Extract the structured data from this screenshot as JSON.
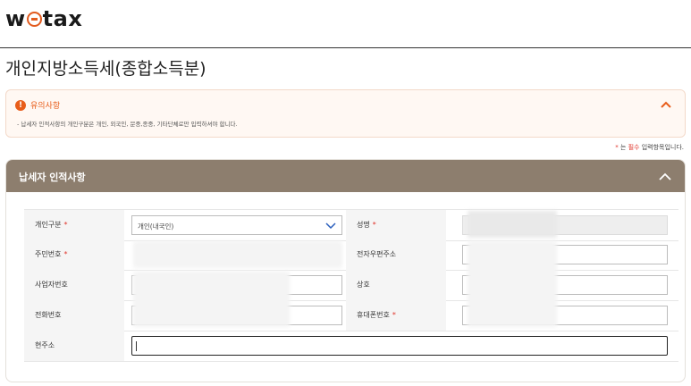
{
  "header": {
    "logo_w": "w",
    "logo_tax": "tax"
  },
  "page": {
    "title": "개인지방소득세(종합소득분)"
  },
  "notice": {
    "icon": "!",
    "title": "유의사항",
    "body": "- 납세자 인적사항의 개인구분은 개인, 외국인, 문중,종중, 기타단체로만 입력하셔야 합니다."
  },
  "required_note": {
    "star": "*",
    "text_a": " 는 ",
    "emphasis": "필수",
    "text_b": " 입력항목입니다."
  },
  "panel": {
    "title": "납세자 인적사항",
    "fields": {
      "individual_type": {
        "label": "개인구분",
        "value": "개인(내국인)"
      },
      "name": {
        "label": "성명"
      },
      "resident_number": {
        "label": "주민번호"
      },
      "email": {
        "label": "전자우편주소"
      },
      "business_number": {
        "label": "사업자번호"
      },
      "company_name": {
        "label": "상호"
      },
      "phone": {
        "label": "전화번호"
      },
      "mobile": {
        "label": "휴대폰번호"
      },
      "address": {
        "label": "현주소"
      }
    },
    "required_star": "*"
  },
  "colors": {
    "accent": "#e85d1a",
    "panel_header": "#8d7e6e",
    "required": "#e0342b"
  },
  "icons": {
    "notice": "alert-circle-icon",
    "collapse": "chevron-up-icon",
    "dropdown": "chevron-down-icon"
  }
}
